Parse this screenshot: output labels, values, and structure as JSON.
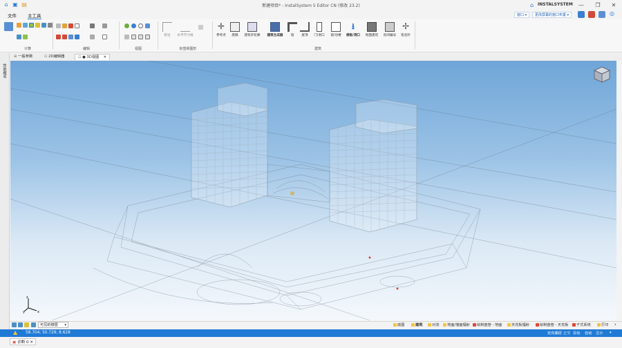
{
  "window": {
    "title": "新建项目* - InstalSystem 5 Editor CN (修改 23.2)",
    "brand": "INSTALSYSTEM",
    "controls": [
      "—",
      "❐",
      "✕"
    ]
  },
  "menu": {
    "file": "文件",
    "main": "主工具"
  },
  "topright": {
    "window_label": "窗口",
    "layout_label": "更改屏幕的窗口布置"
  },
  "ribbon": {
    "groups": [
      {
        "label": "计算"
      },
      {
        "label": "编辑"
      },
      {
        "label": "视图"
      },
      {
        "label": "标签和图形"
      },
      {
        "label": "建筑"
      }
    ],
    "view_tools": {
      "mark": "标注",
      "hdim": "水平尺寸线"
    },
    "building_tools": [
      "参考点",
      "底稿",
      "建筑外轮廓",
      "建筑生成器",
      "墙",
      "屋顶",
      "门/洞口",
      "窗/功楼",
      "楼板/洞口",
      "地面建筑",
      "房间编号",
      "指北针"
    ]
  },
  "doctabs": [
    {
      "label": "一般参数",
      "active": false
    },
    {
      "label": "2D编辑器",
      "active": false
    },
    {
      "label": "● 3D视图",
      "active": true
    }
  ],
  "sidepanel": {
    "label": "性能概览"
  },
  "bottombar": {
    "visible_floors": "可见的楼层",
    "layers": [
      {
        "label": "底图",
        "color": "#f4c542"
      },
      {
        "label": "建筑",
        "color": "#f4c542"
      },
      {
        "label": "对流",
        "color": "#f4c542"
      },
      {
        "label": "地面/墙面辐射",
        "color": "#f4c542"
      },
      {
        "label": "绘制盘管 - 地面",
        "color": "#e04a3a"
      },
      {
        "label": "天花板辐射",
        "color": "#f4c542"
      },
      {
        "label": "绘制盘管 - 天花板",
        "color": "#e04a3a"
      },
      {
        "label": "干式系统",
        "color": "#e04a3a"
      },
      {
        "label": "打印",
        "color": "#f4c542"
      }
    ]
  },
  "status": {
    "coords": "58.704; 50.729; 8.628",
    "items": [
      {
        "label": "定向捕捉",
        "dim": false
      },
      {
        "label": "正交",
        "dim": true
      },
      {
        "label": "极轴",
        "dim": true
      },
      {
        "label": "自动",
        "dim": false
      },
      {
        "label": "显示",
        "dim": true
      }
    ]
  },
  "bottomtab": {
    "label": "诊断 0"
  },
  "colors": {
    "accent": "#1f7ad6",
    "sky_top": "#6fa6d8",
    "sky_bottom": "#f4f8fc"
  }
}
